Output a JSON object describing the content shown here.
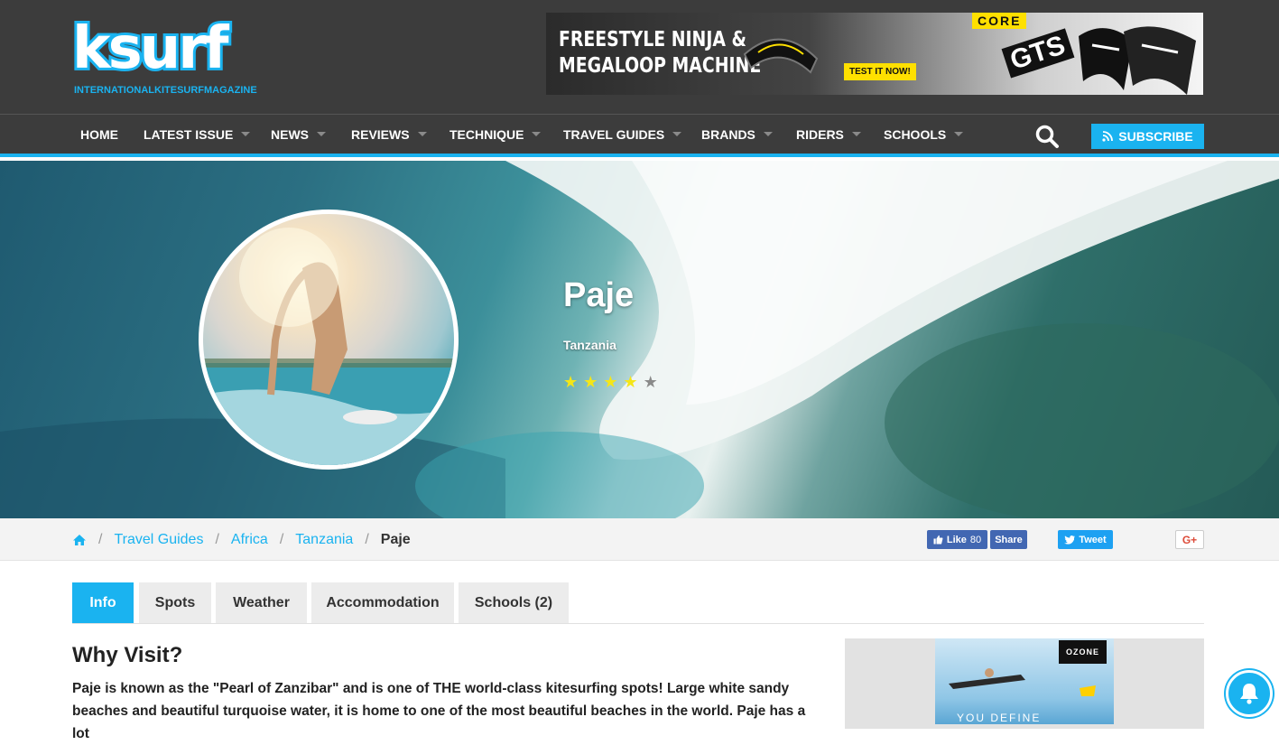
{
  "header": {
    "logo_text": "ksurf",
    "logo_subtitle": "INTERNATIONALKITESURFMAGAZINE",
    "ad": {
      "headline_line1": "FREESTYLE NINJA &",
      "headline_line2": "MEGALOOP MACHINE",
      "cta": "TEST IT NOW!",
      "brand": "CORE",
      "model": "GTS"
    }
  },
  "nav": {
    "items": [
      {
        "label": "HOME",
        "has_dropdown": false
      },
      {
        "label": "LATEST ISSUE",
        "has_dropdown": true
      },
      {
        "label": "NEWS",
        "has_dropdown": true
      },
      {
        "label": "REVIEWS",
        "has_dropdown": true
      },
      {
        "label": "TECHNIQUE",
        "has_dropdown": true
      },
      {
        "label": "TRAVEL GUIDES",
        "has_dropdown": true
      },
      {
        "label": "BRANDS",
        "has_dropdown": true
      },
      {
        "label": "RIDERS",
        "has_dropdown": true
      },
      {
        "label": "SCHOOLS",
        "has_dropdown": true
      }
    ],
    "subscribe_label": "SUBSCRIBE",
    "search_icon": "search-icon",
    "accent_color": "#1ab3f0"
  },
  "hero": {
    "title": "Paje",
    "subtitle": "Tanzania",
    "rating": 4,
    "rating_max": 5
  },
  "breadcrumb": {
    "home_icon": "home-icon",
    "links": [
      "Travel Guides",
      "Africa",
      "Tanzania"
    ],
    "current": "Paje",
    "separator": "/"
  },
  "social": {
    "fb_like_label": "Like",
    "fb_like_count": "80",
    "fb_share_label": "Share",
    "tweet_label": "Tweet",
    "gplus_label": "G+"
  },
  "tabs": [
    {
      "label": "Info",
      "active": true
    },
    {
      "label": "Spots",
      "active": false
    },
    {
      "label": "Weather",
      "active": false
    },
    {
      "label": "Accommodation",
      "active": false
    },
    {
      "label": "Schools (2)",
      "active": false
    }
  ],
  "content": {
    "section_title": "Why Visit?",
    "section_text": "Paje is known as the \"Pearl of Zanzibar\" and is one of THE world-class kitesurfing spots! Large white sandy beaches and beautiful turquoise water, it is home to one of the most beautiful beaches in the world. Paje has a lot"
  },
  "sidebar_ad": {
    "brand": "OZONE",
    "tagline": "YOU DEFINE"
  }
}
